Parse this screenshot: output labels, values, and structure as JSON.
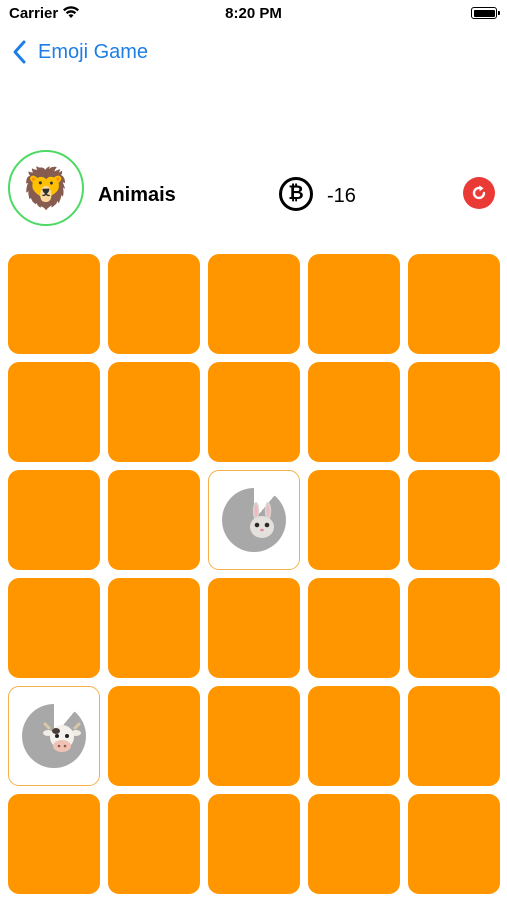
{
  "status_bar": {
    "carrier": "Carrier",
    "time": "8:20 PM"
  },
  "nav": {
    "back_label": "Emoji Game"
  },
  "header": {
    "avatar_emoji": "🦁",
    "category": "Animais",
    "coin_symbol": "₿",
    "score": "-16"
  },
  "colors": {
    "card_back": "#ff9600",
    "accent_blue": "#1e7ee6",
    "restart_red": "#ea3a36",
    "avatar_ring": "#4cd964"
  },
  "grid": {
    "rows": 6,
    "cols": 5,
    "revealed": [
      {
        "row": 2,
        "col": 2,
        "animal": "rabbit"
      },
      {
        "row": 4,
        "col": 0,
        "animal": "cow"
      }
    ]
  }
}
